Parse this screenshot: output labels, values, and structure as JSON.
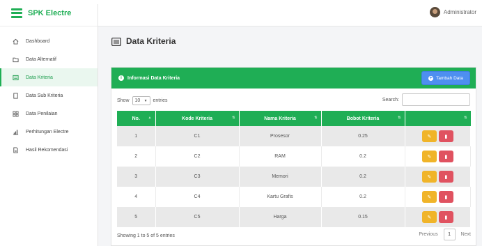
{
  "app": {
    "brand": "SPK Electre"
  },
  "topbar": {
    "user_name": "Administrator"
  },
  "sidebar": {
    "items": [
      {
        "label": "Dashboard",
        "icon": "home-icon"
      },
      {
        "label": "Data Alternatif",
        "icon": "folder-icon"
      },
      {
        "label": "Data Kriteria",
        "icon": "list-box-icon"
      },
      {
        "label": "Data Sub Kriteria",
        "icon": "file-icon"
      },
      {
        "label": "Data Penilaian",
        "icon": "grid-icon"
      },
      {
        "label": "Perhitungan Electre",
        "icon": "bar-chart-icon"
      },
      {
        "label": "Hasil Rekomendasi",
        "icon": "document-icon"
      }
    ],
    "active_index": 2
  },
  "page": {
    "title": "Data Kriteria"
  },
  "card": {
    "title": "Informasi Data Kriteria",
    "add_button": "Tambah Data",
    "show_label": "Show",
    "entries_value": "10",
    "entries_label": "entries",
    "search_label": "Search:",
    "search_value": ""
  },
  "table": {
    "columns": [
      "No.",
      "Kode Kriteria",
      "Nama Kriteria",
      "Bobot Kriteria",
      ""
    ],
    "rows": [
      {
        "no": "1",
        "kode": "C1",
        "nama": "Prosesor",
        "bobot": "0.25"
      },
      {
        "no": "2",
        "kode": "C2",
        "nama": "RAM",
        "bobot": "0.2"
      },
      {
        "no": "3",
        "kode": "C3",
        "nama": "Memori",
        "bobot": "0.2"
      },
      {
        "no": "4",
        "kode": "C4",
        "nama": "Kartu Grafis",
        "bobot": "0.2"
      },
      {
        "no": "5",
        "kode": "C5",
        "nama": "Harga",
        "bobot": "0.15"
      }
    ]
  },
  "footer": {
    "info": "Showing 1 to 5 of 5 entries",
    "previous": "Previous",
    "page": "1",
    "next": "Next"
  },
  "colors": {
    "primary_green": "#1fae55",
    "add_blue": "#4e8ff0",
    "edit_yellow": "#f0b429",
    "delete_red": "#e05260"
  }
}
